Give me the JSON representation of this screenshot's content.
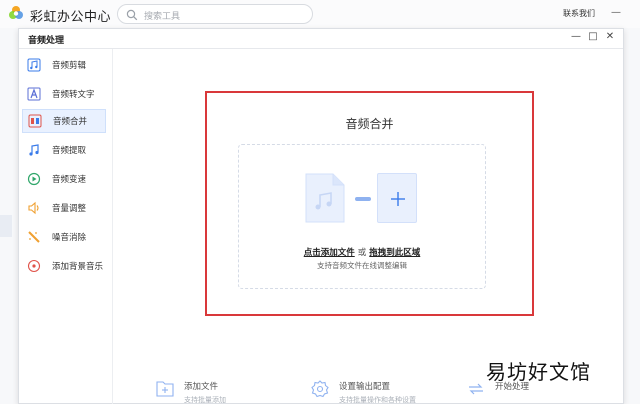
{
  "app": {
    "title": "彩虹办公中心",
    "contact": "联系我们",
    "minimize": "—"
  },
  "search": {
    "placeholder": "搜索工具"
  },
  "dialog": {
    "title": "音频处理",
    "min": "—",
    "max": "□",
    "close": "✕"
  },
  "sidebar": {
    "items": [
      {
        "label": "音频剪辑",
        "icon": "audio-clip-icon"
      },
      {
        "label": "音频转文字",
        "icon": "text-A-icon"
      },
      {
        "label": "音频合并",
        "icon": "audio-merge-icon",
        "active": true
      },
      {
        "label": "音频提取",
        "icon": "audio-extract-icon"
      },
      {
        "label": "音频变速",
        "icon": "speed-icon"
      },
      {
        "label": "音量调整",
        "icon": "volume-icon"
      },
      {
        "label": "噪音消除",
        "icon": "noise-wand-icon"
      },
      {
        "label": "添加背景音乐",
        "icon": "music-disc-icon"
      }
    ]
  },
  "panel": {
    "title": "音频合并",
    "click_add": "点击添加文件",
    "or": "或",
    "drag_here": "拖拽到此区域",
    "hint": "支持音频文件在线调整编辑"
  },
  "actions": {
    "add_file": {
      "title": "添加文件",
      "sub": "支持批量添加"
    },
    "output": {
      "title": "设置输出配置",
      "sub": "支持批量操作和各种设置"
    },
    "start": {
      "title": "开始处理"
    }
  },
  "watermark": "易坊好文馆",
  "colors": {
    "accent": "#3a7bea",
    "highlight_border": "#d9383a"
  }
}
